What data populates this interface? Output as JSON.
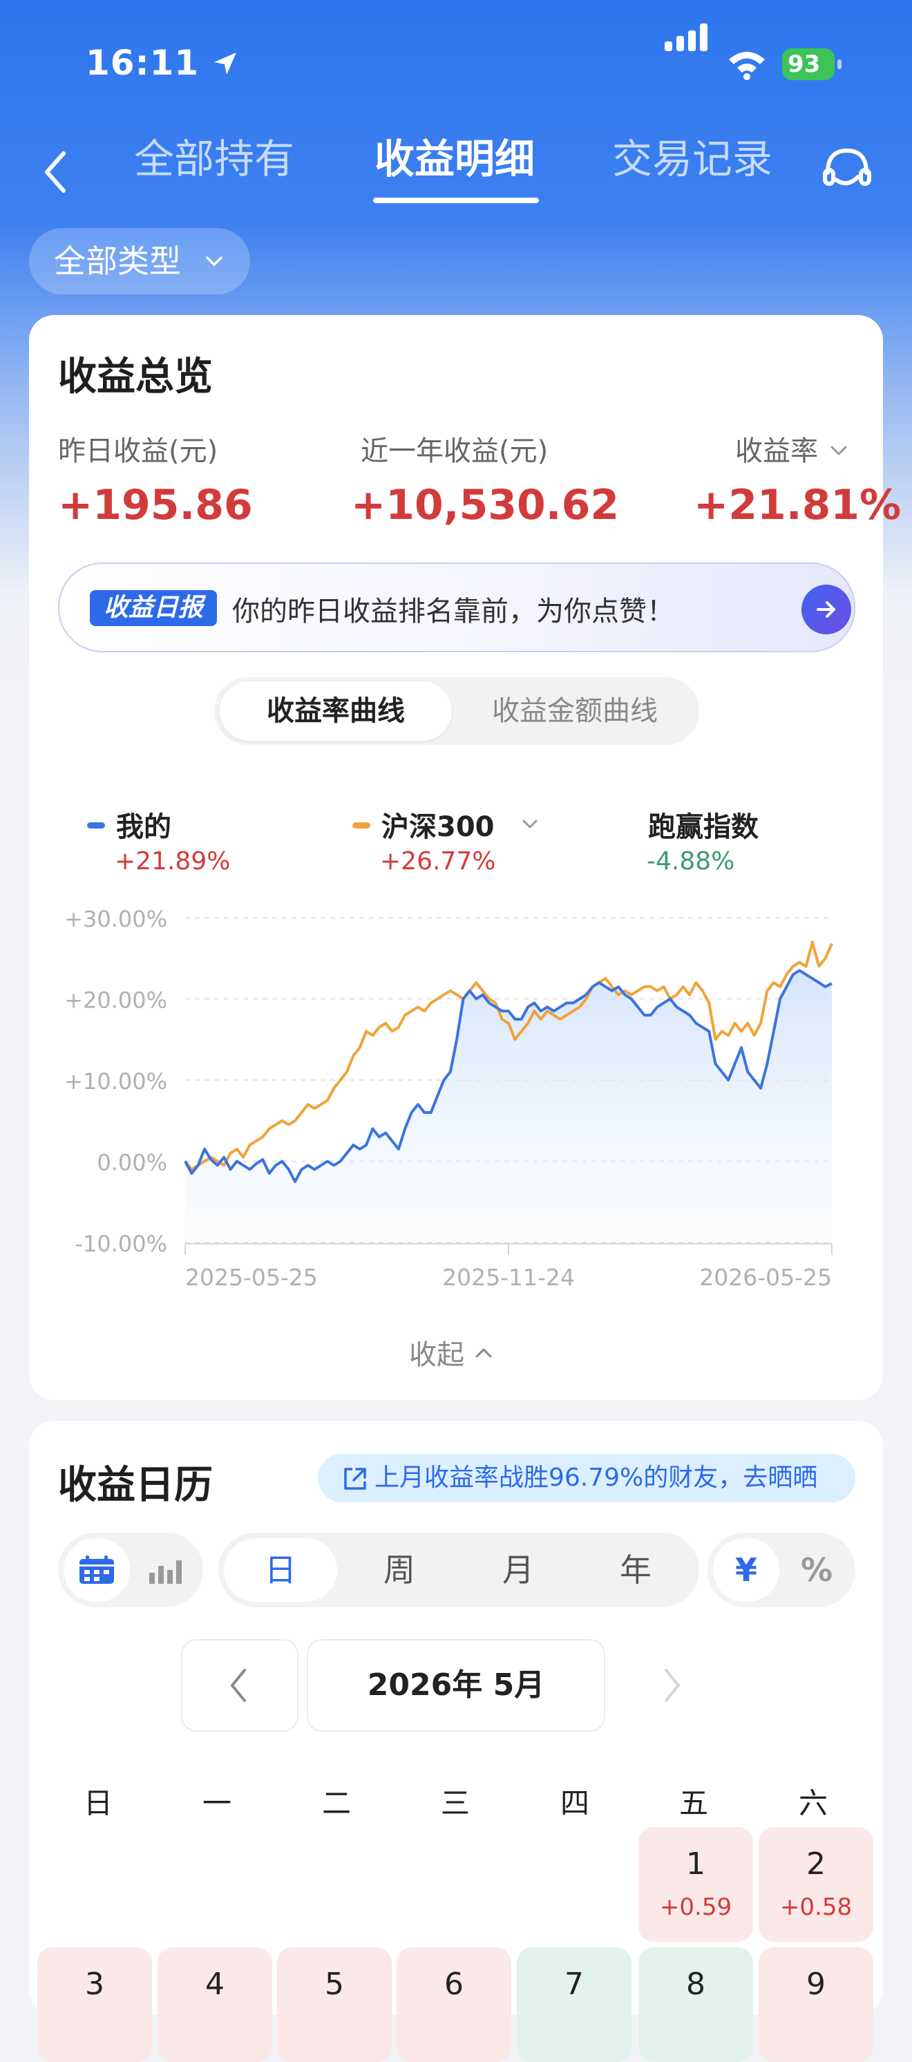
{
  "status_bar": {
    "time": "16:11",
    "battery": "93"
  },
  "nav": {
    "tabs": [
      {
        "label": "全部持有",
        "active": false
      },
      {
        "label": "收益明细",
        "active": true
      },
      {
        "label": "交易记录",
        "active": false
      }
    ]
  },
  "filter": {
    "label": "全部类型"
  },
  "overview": {
    "title": "收益总览",
    "metrics": [
      {
        "label": "昨日收益(元)",
        "value": "+195.86"
      },
      {
        "label": "近一年收益(元)",
        "value": "+10,530.62"
      },
      {
        "label": "收益率",
        "value": "+21.81%"
      }
    ],
    "banner": {
      "badge": "收益日报",
      "text": "你的昨日收益排名靠前，为你点赞！"
    },
    "segments": [
      "收益率曲线",
      "收益金额曲线"
    ],
    "legend": [
      {
        "name": "我的",
        "value": "+21.89%",
        "color": "#3b74e0",
        "value_color": "#d23b3b"
      },
      {
        "name": "沪深300",
        "value": "+26.77%",
        "color": "#f0a33a",
        "value_color": "#d23b3b"
      },
      {
        "name": "跑赢指数",
        "value": "-4.88%",
        "value_color": "#3b9a6e"
      }
    ],
    "collapse_label": "收起"
  },
  "chart_data": {
    "type": "line",
    "y_ticks": [
      "+30.00%",
      "+20.00%",
      "+10.00%",
      "0.00%",
      "-10.00%"
    ],
    "ylim": [
      -10,
      30
    ],
    "x_ticks": [
      "2025-05-25",
      "2025-11-24",
      "2026-05-25"
    ],
    "series": [
      {
        "name": "我的",
        "color": "#3b74e0",
        "values": [
          0,
          -1.5,
          -0.5,
          1.5,
          0.2,
          -0.5,
          0.5,
          -1,
          0,
          -0.5,
          -1,
          -0.3,
          0.2,
          -1.5,
          -0.5,
          0,
          -1,
          -2.5,
          -1,
          -0.5,
          -1,
          -0.5,
          0,
          -0.5,
          0,
          1,
          2,
          1.5,
          2,
          4,
          3,
          3.5,
          2.5,
          1.5,
          4,
          6,
          7,
          6,
          6,
          8,
          10,
          11,
          15,
          20,
          21,
          20,
          20.5,
          19.5,
          19,
          18.5,
          18.5,
          17.5,
          17.5,
          19,
          19.5,
          18.5,
          19,
          18.5,
          19,
          19.5,
          19.5,
          20,
          20.5,
          21.5,
          22,
          21.5,
          21,
          21.5,
          20.5,
          20,
          19,
          18,
          18,
          19,
          19.5,
          20,
          19,
          18.5,
          18,
          17,
          16.5,
          16,
          12,
          11,
          10,
          12,
          14,
          11,
          10,
          9,
          12,
          16,
          20,
          21.5,
          23,
          23.5,
          23,
          22.5,
          22,
          21.5,
          21.9
        ]
      },
      {
        "name": "沪深300",
        "color": "#f0a33a",
        "values": [
          0,
          -1,
          -0.5,
          0,
          0.5,
          0,
          -0.5,
          1,
          1.5,
          0.5,
          2,
          2.5,
          3,
          4,
          4.5,
          5,
          4.5,
          5,
          6,
          7,
          6.5,
          7,
          7.5,
          9,
          10,
          11,
          13,
          14,
          16,
          15.5,
          16.5,
          17,
          16,
          16.5,
          18,
          18.5,
          19,
          18.5,
          19.5,
          20,
          20.5,
          21,
          20.5,
          20,
          21,
          22,
          21,
          20,
          19.5,
          17.5,
          17,
          15,
          16,
          17,
          18.5,
          17.5,
          18.5,
          18,
          17.5,
          18,
          18.5,
          19,
          20,
          21.5,
          22,
          22.5,
          21.5,
          20.5,
          21,
          20.5,
          21,
          21.5,
          21.5,
          21,
          21.5,
          20,
          20.5,
          21.5,
          20.5,
          22,
          21,
          19.5,
          15,
          16,
          15.5,
          17,
          16,
          17,
          15.5,
          17,
          21,
          22,
          21.5,
          23,
          24,
          24.5,
          24,
          27,
          24,
          25,
          26.8
        ]
      }
    ]
  },
  "calendar": {
    "title": "收益日历",
    "share_text": "上月收益率战胜96.79%的财友，去晒晒",
    "periods": [
      "日",
      "周",
      "月",
      "年"
    ],
    "units": [
      "¥",
      "%"
    ],
    "month": "2026年 5月",
    "weekdays": [
      "日",
      "一",
      "二",
      "三",
      "四",
      "五",
      "六"
    ],
    "days": [
      {
        "d": "1",
        "v": "+0.59"
      },
      {
        "d": "2",
        "v": "+0.58"
      }
    ],
    "next_row_days": [
      "3",
      "4",
      "5",
      "6",
      "7",
      "8",
      "9"
    ]
  },
  "colors": {
    "brand": "#2f76ee",
    "gain": "#d23b3b",
    "loss": "#3b9a6e"
  }
}
